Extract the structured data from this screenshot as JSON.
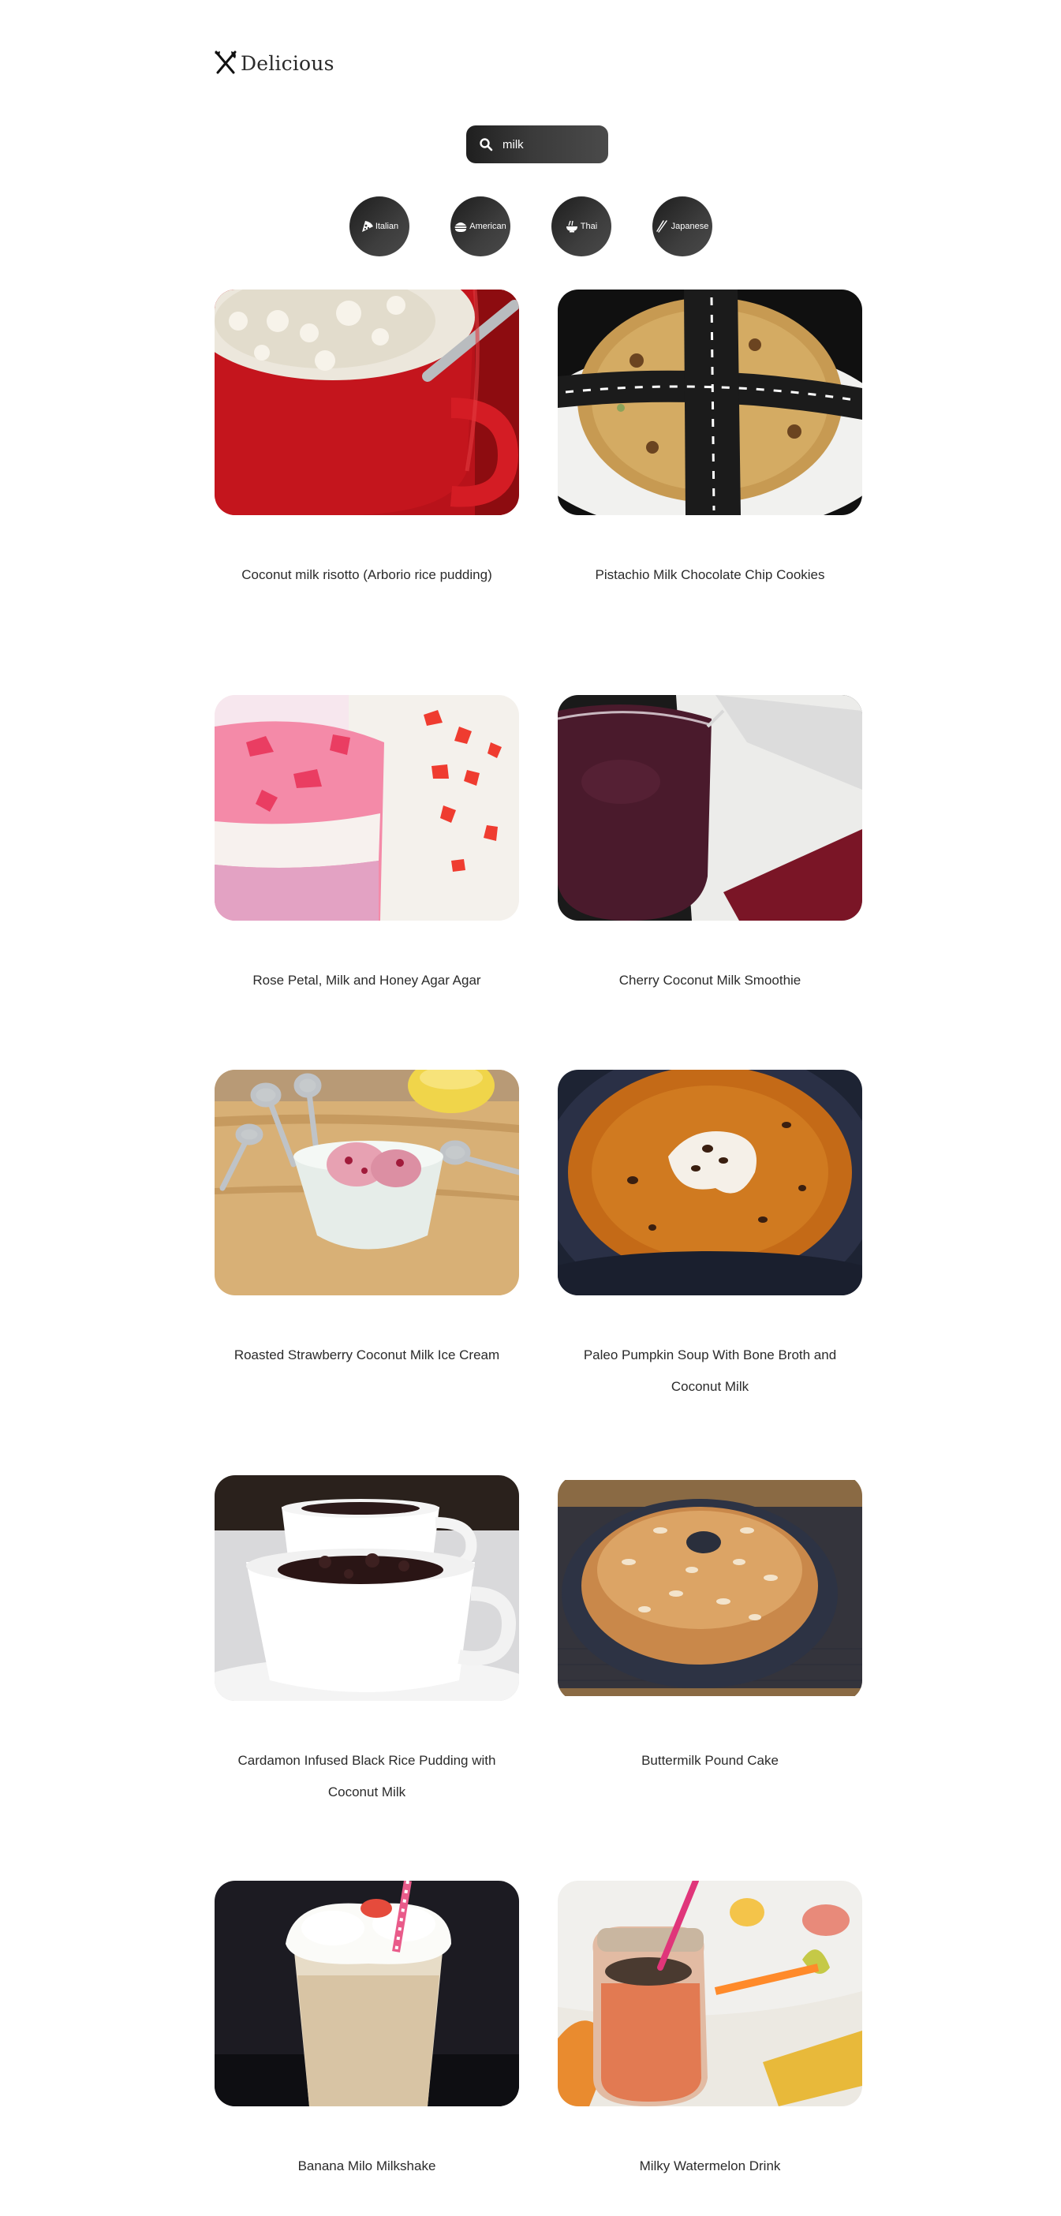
{
  "brand": {
    "name": "Delicious"
  },
  "search": {
    "value": "milk"
  },
  "cuisines": [
    {
      "label": "Italian"
    },
    {
      "label": "American"
    },
    {
      "label": "Thai"
    },
    {
      "label": "Japanese"
    }
  ],
  "recipes": [
    {
      "title": "Coconut milk risotto (Arborio rice pudding)"
    },
    {
      "title": "Pistachio Milk Chocolate Chip Cookies"
    },
    {
      "title": "Rose Petal, Milk and Honey Agar Agar"
    },
    {
      "title": "Cherry Coconut Milk Smoothie"
    },
    {
      "title": "Roasted Strawberry Coconut Milk Ice Cream"
    },
    {
      "title": "Paleo Pumpkin Soup With Bone Broth and Coconut Milk"
    },
    {
      "title": "Cardamon Infused Black Rice Pudding with Coconut Milk"
    },
    {
      "title": "Buttermilk Pound Cake"
    },
    {
      "title": "Banana Milo Milkshake"
    },
    {
      "title": "Milky Watermelon Drink"
    }
  ]
}
